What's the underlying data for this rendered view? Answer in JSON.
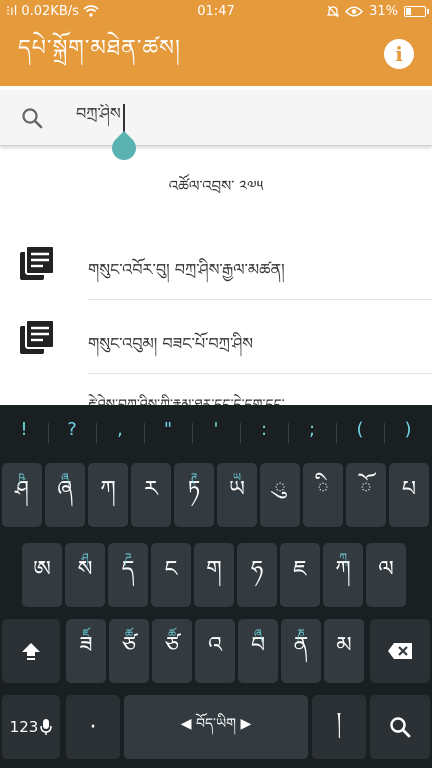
{
  "status_bar": {
    "carrier_signal": "⁝ıl",
    "speed": "0.02KB/s",
    "time": "01:47",
    "battery": "31%",
    "battery_level": 0.31
  },
  "app_bar": {
    "title": "དཔེ་སྐྲོག་མཐེན་ཚས།",
    "info_label": "i"
  },
  "search": {
    "value": "བཀྲ་ཤིས",
    "placeholder": ""
  },
  "year_line": "འཚོལ་འབྲས་ ༢༧༥",
  "results": [
    {
      "label": "གསུང་འབོར་བུ། བཀྲ་ཤིས་རྒྱལ་མཚན།",
      "icon": "book-list-icon"
    },
    {
      "label": "གསུང་འབུམ། བཟང་པོ་བཀྲ་ཤིས",
      "icon": "book-list-icon"
    }
  ],
  "partial_result": "རྗེ་ཤེས་བཀྲ་ཤིས་ཀྱི་རྣམ་ཐར་དང་དེ་དག་དང་",
  "keyboard": {
    "symbols": [
      "!",
      "?",
      ",",
      "\"",
      "'",
      ":",
      ";",
      "(",
      ")"
    ],
    "row1": [
      {
        "main": "ཤ",
        "hint": "ཥ"
      },
      {
        "main": "ཞ",
        "hint": "ཞ"
      },
      {
        "main": "ཀ",
        "hint": ""
      },
      {
        "main": "ར",
        "hint": ""
      },
      {
        "main": "ཏ",
        "hint": "ཊ"
      },
      {
        "main": "ཡ",
        "hint": "ཡ"
      },
      {
        "main": "ུ",
        "hint": ""
      },
      {
        "main": "ི",
        "hint": ""
      },
      {
        "main": "ོ",
        "hint": ""
      },
      {
        "main": "པ",
        "hint": ""
      }
    ],
    "row2": [
      {
        "main": "ཨ",
        "hint": ""
      },
      {
        "main": "ས",
        "hint": "ཤ"
      },
      {
        "main": "ད",
        "hint": "ཌ"
      },
      {
        "main": "ང",
        "hint": ""
      },
      {
        "main": "ག",
        "hint": ""
      },
      {
        "main": "ཧ",
        "hint": ""
      },
      {
        "main": "ཇ",
        "hint": ""
      },
      {
        "main": "ཀ",
        "hint": "ཀ"
      },
      {
        "main": "ལ",
        "hint": ""
      }
    ],
    "row3": [
      {
        "main": "ཟ",
        "hint": "ཛ"
      },
      {
        "main": "ཙ",
        "hint": "ཚ"
      },
      {
        "main": "ཙ",
        "hint": "ཚ"
      },
      {
        "main": "འ",
        "hint": ""
      },
      {
        "main": "བ",
        "hint": "ཞ"
      },
      {
        "main": "ན",
        "hint": "ཎ"
      },
      {
        "main": "མ",
        "hint": ""
      }
    ],
    "num_label": "123",
    "comma_label": "·",
    "space_label": "◀ བོད་ཡིག ▶",
    "period_label": "།",
    "shift_icon": "shift-up-icon",
    "backspace_icon": "backspace-icon",
    "mic_icon": "microphone-icon",
    "search_icon": "search-icon"
  }
}
